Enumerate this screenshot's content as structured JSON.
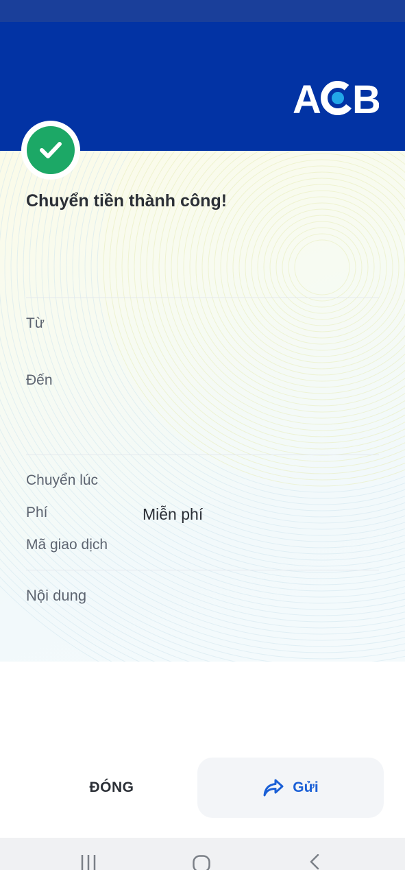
{
  "brand": {
    "logo_text": "ACB",
    "primary_color": "#0233a4",
    "success_color": "#1ca866",
    "link_color": "#1a5fd6"
  },
  "status": {
    "icon": "check-icon",
    "title": "Chuyển tiền thành công!"
  },
  "details": {
    "from_label": "Từ",
    "to_label": "Đến",
    "time_label": "Chuyển lúc",
    "fee_label": "Phí",
    "fee_value": "Miễn phí",
    "txn_id_label": "Mã giao dịch",
    "content_label": "Nội dung"
  },
  "actions": {
    "close_label": "ĐÓNG",
    "send_label": "Gửi",
    "send_icon": "share-arrow-icon"
  },
  "navigation": {
    "recent_icon": "recent-apps-icon",
    "home_icon": "home-icon",
    "back_icon": "back-icon"
  }
}
